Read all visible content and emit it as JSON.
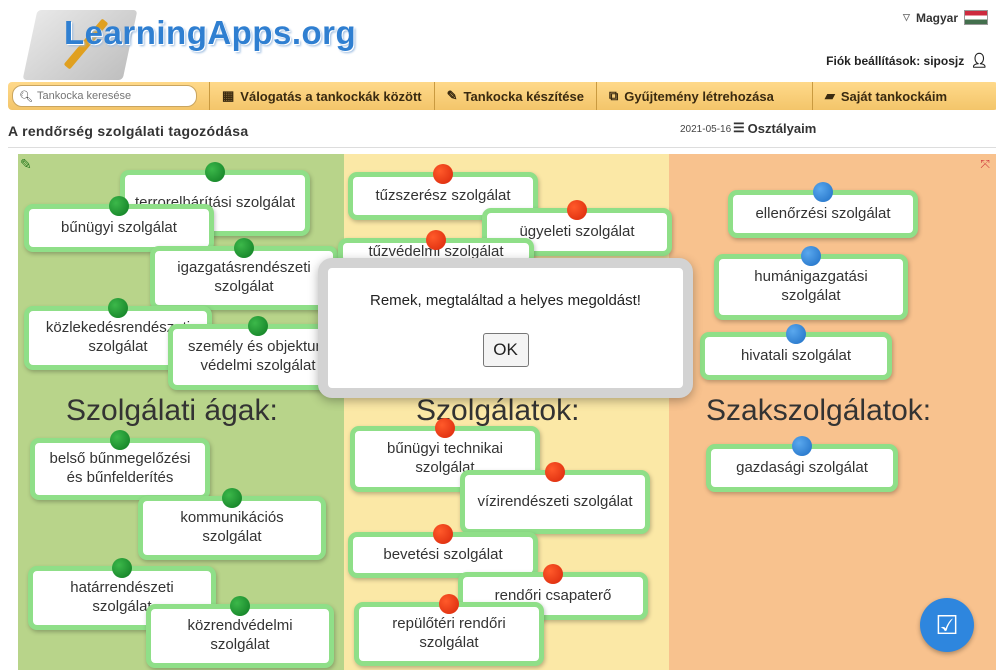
{
  "header": {
    "logo_text": "LearningApps.org",
    "language": "Magyar",
    "account_label": "Fiók beállítások: siposjz"
  },
  "navbar": {
    "search_placeholder": "Tankocka keresése",
    "items": [
      {
        "label": "Válogatás a tankockák között",
        "icon": "grid-icon"
      },
      {
        "label": "Tankocka készítése",
        "icon": "pencil-icon"
      },
      {
        "label": "Gyűjtemény létrehozása",
        "icon": "collection-icon"
      },
      {
        "label": "Saját tankockáim",
        "icon": "folder-icon"
      }
    ]
  },
  "page": {
    "title": "A rendőrség szolgálati tagozódása",
    "date": "2021-05-16",
    "classes_label": "Osztályaim"
  },
  "columns": {
    "headings": [
      "Szolgálati ágak:",
      "Szolgálatok:",
      "Szakszolgálatok:"
    ]
  },
  "cards": {
    "terrorelharitasi": "terrorelhárítási szolgálat",
    "bunugyi": "bűnügyi szolgálat",
    "igazgatasrendeszeti": "igazgatásrendészeti szolgálat",
    "kozlekedesrendeszeti": "közlekedésrendészeti szolgálat",
    "szemely": "személy és objektum védelmi szolgálat",
    "belso": "belső bűnmegelőzési és bűnfelderítés",
    "kommunikacios": "kommunikációs szolgálat",
    "hatarrendeszeti": "határrendészeti szolgálat",
    "kozrendvedelmi": "közrendvédelmi szolgálat",
    "tuzszeresz": "tűzszerész szolgálat",
    "ugyeleti": "ügyeleti szolgálat",
    "tuzvedelmi": "tűzvédelmi szolgálat",
    "bunugyi_technikai": "bűnügyi technikai szolgálat",
    "vizirendeszeti": "vízirendészeti szolgálat",
    "bevetesi": "bevetési szolgálat",
    "rendori_csapaterő": "rendőri csapaterő",
    "repuloteri": "repülőtéri rendőri szolgálat",
    "ellenorzesi": "ellenőrzési szolgálat",
    "humanigazgatasi": "humánigazgatási szolgálat",
    "hivatali": "hivatali szolgálat",
    "gazdasagi": "gazdasági szolgálat"
  },
  "dialog": {
    "message": "Remek, megtaláltad a helyes megoldást!",
    "ok_label": "OK"
  },
  "colors": {
    "col1": "#b8d48a",
    "col2": "#fbe8a6",
    "col3": "#f8c28e",
    "card_border": "#8fdf88",
    "pin_green": "#1a9a30",
    "pin_red": "#f03a14",
    "pin_blue": "#2e86de"
  }
}
